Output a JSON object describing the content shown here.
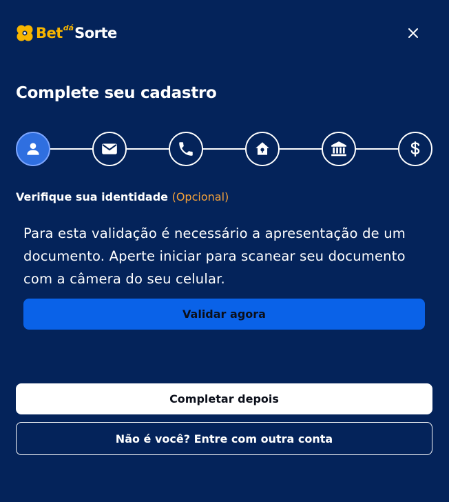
{
  "logo": {
    "bet": "Bet",
    "da": "dá",
    "sorte": "Sorte"
  },
  "title": "Complete seu cadastro",
  "steps": [
    {
      "icon": "user-icon",
      "active": true
    },
    {
      "icon": "mail-icon",
      "active": false
    },
    {
      "icon": "phone-icon",
      "active": false
    },
    {
      "icon": "home-icon",
      "active": false
    },
    {
      "icon": "bank-icon",
      "active": false
    },
    {
      "icon": "dollar-icon",
      "active": false
    }
  ],
  "section": {
    "label": "Verifique sua identidade",
    "optional": "(Opcional)"
  },
  "info_text": "Para esta validação é necessário a apresentação de um documento. Aperte iniciar para scanear seu documento com a câmera do seu celular.",
  "buttons": {
    "validate": "Validar agora",
    "later": "Completar depois",
    "other_account": "Não é você? Entre com outra conta"
  },
  "colors": {
    "background": "#04235a",
    "accent": "#f7b500",
    "primary_button": "#0a62e8",
    "optional_text": "#f7a33a",
    "active_step": "#2f6fe0"
  }
}
